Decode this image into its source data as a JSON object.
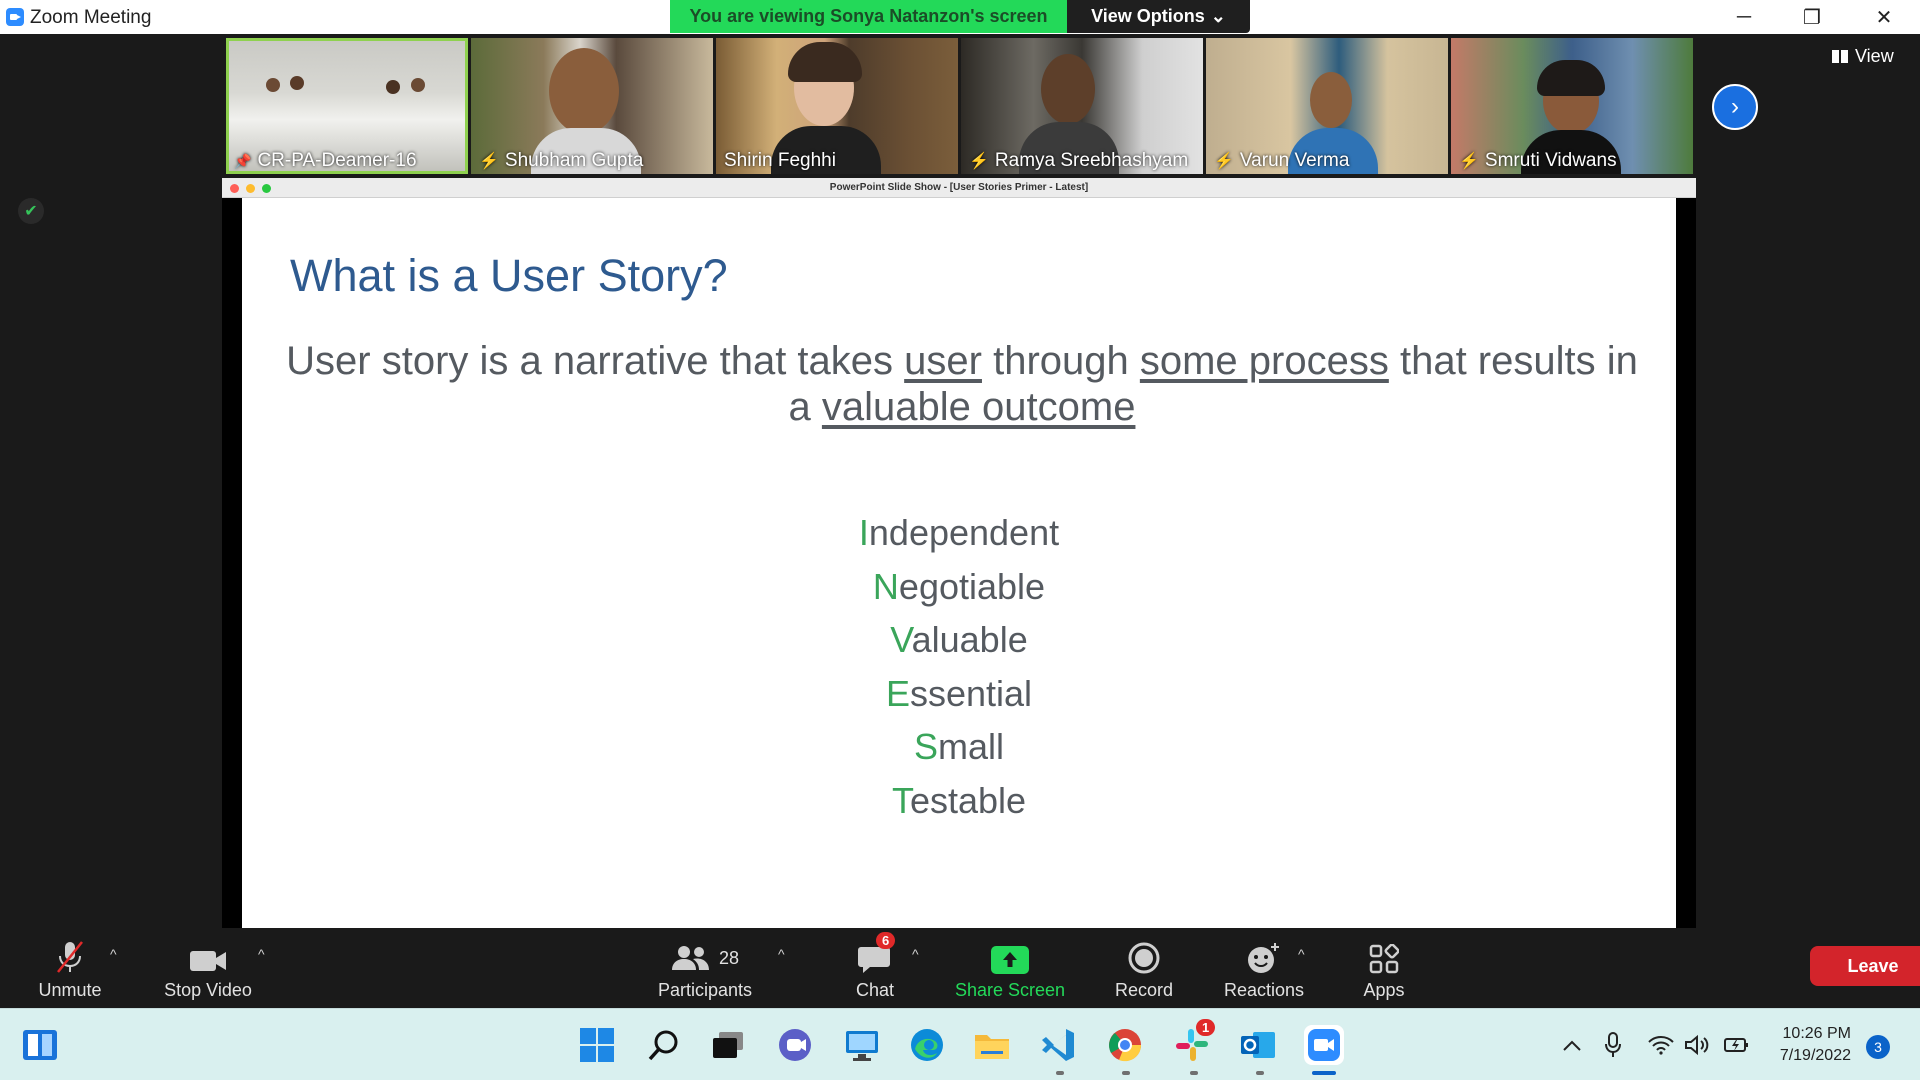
{
  "window": {
    "title": "Zoom Meeting",
    "viewing_banner": "You are viewing Sonya Natanzon's screen",
    "view_options_label": "View Options",
    "view_options_chevron": "⌄",
    "minimize_glyph": "─",
    "maximize_glyph": "❐",
    "close_glyph": "✕"
  },
  "gallery": {
    "tiles": [
      {
        "name": "CR-PA-Deamer-16",
        "pinned": true,
        "muted": false
      },
      {
        "name": "Shubham Gupta",
        "muted": true
      },
      {
        "name": "Shirin Feghhi",
        "muted": false
      },
      {
        "name": "Ramya Sreebhashyam",
        "muted": true
      },
      {
        "name": "Varun Verma",
        "muted": true
      },
      {
        "name": "Smruti Vidwans",
        "muted": true
      }
    ],
    "next_icon": "›",
    "view_label": "View",
    "pin_glyph": "📌",
    "muted_glyph": "⚡"
  },
  "share": {
    "window_title": "PowerPoint Slide Show - [User Stories Primer - Latest]",
    "slide": {
      "title": "What is a User Story?",
      "body_parts": {
        "p1": "User story is a narrative that takes ",
        "u1": "user",
        "p2": " through ",
        "u2": "some process",
        "p3": " that results in a ",
        "u3": "valuable outcome"
      },
      "invest": [
        {
          "first": "I",
          "rest": "ndependent"
        },
        {
          "first": "N",
          "rest": "egotiable"
        },
        {
          "first": "V",
          "rest": "aluable"
        },
        {
          "first": "E",
          "rest": "ssential"
        },
        {
          "first": "S",
          "rest": "mall"
        },
        {
          "first": "T",
          "rest": "estable"
        }
      ],
      "title_color": "#2e5a8f",
      "accent_color": "#3aa55a"
    }
  },
  "toolbar": {
    "unmute": "Unmute",
    "stop_video": "Stop Video",
    "participants": "Participants",
    "participants_count": "28",
    "chat": "Chat",
    "chat_badge": "6",
    "share_screen": "Share Screen",
    "record": "Record",
    "reactions": "Reactions",
    "apps": "Apps",
    "leave": "Leave",
    "caret": "^",
    "share_color": "#23d959",
    "leave_color": "#d3242b"
  },
  "taskbar": {
    "time": "10:26 PM",
    "date": "7/19/2022",
    "notification_count": "3",
    "slack_badge": "1"
  }
}
